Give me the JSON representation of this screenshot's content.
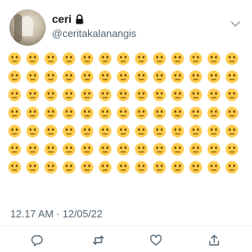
{
  "tweet": {
    "author": {
      "name": "ceri",
      "handle": "@ceritakalanangis",
      "protected": true
    },
    "body": {
      "emoji": "😐",
      "emoji_name": "neutral-face",
      "rows": 7,
      "per_row": 13
    },
    "timestamp": "12.17 AM · 12/05/22",
    "actions": [
      "reply",
      "retweet",
      "like",
      "share"
    ]
  },
  "colors": {
    "text": "#0f1419",
    "secondary": "#536471",
    "emoji_face": "#ffcc4d",
    "emoji_features": "#664500"
  },
  "icons": [
    "lock-icon",
    "chevron-down-icon",
    "reply-icon",
    "retweet-icon",
    "like-icon",
    "share-icon"
  ]
}
